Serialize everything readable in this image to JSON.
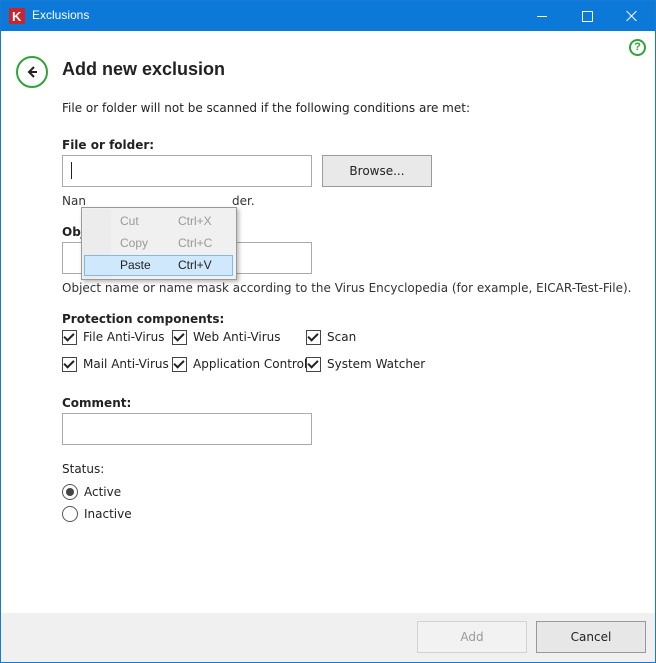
{
  "window": {
    "title": "Exclusions",
    "logo_letter": "K"
  },
  "page": {
    "heading": "Add new exclusion",
    "intro": "File or folder will not be scanned if the following conditions are met:"
  },
  "file_or_folder": {
    "label": "File or folder:",
    "value": "",
    "browse_label": "Browse...",
    "hint_start": "Nan",
    "hint_end": "der."
  },
  "object": {
    "label_fragment": "Obj",
    "value": "",
    "hint": "Object name or name mask according to the Virus Encyclopedia (for example, EICAR-Test-File)."
  },
  "protection": {
    "label": "Protection components:",
    "components": [
      {
        "label": "File Anti-Virus",
        "checked": true
      },
      {
        "label": "Web Anti-Virus",
        "checked": true
      },
      {
        "label": "Scan",
        "checked": true
      },
      {
        "label": "Mail Anti-Virus",
        "checked": true
      },
      {
        "label": "Application Control",
        "checked": true
      },
      {
        "label": "System Watcher",
        "checked": true
      }
    ]
  },
  "comment": {
    "label": "Comment:",
    "value": ""
  },
  "status": {
    "label": "Status:",
    "options": [
      {
        "label": "Active",
        "selected": true
      },
      {
        "label": "Inactive",
        "selected": false
      }
    ]
  },
  "context_menu": {
    "items": [
      {
        "label": "Cut",
        "shortcut": "Ctrl+X",
        "enabled": false
      },
      {
        "label": "Copy",
        "shortcut": "Ctrl+C",
        "enabled": false
      },
      {
        "label": "Paste",
        "shortcut": "Ctrl+V",
        "enabled": true,
        "highlighted": true
      }
    ]
  },
  "footer": {
    "add_label": "Add",
    "cancel_label": "Cancel"
  },
  "icons": {
    "help": "help-icon",
    "back": "back-arrow-icon",
    "app": "kaspersky-logo-icon"
  },
  "colors": {
    "title_bar": "#0c78d8",
    "accent_green": "#2fa33a",
    "menu_highlight": "#cfe8fb"
  }
}
